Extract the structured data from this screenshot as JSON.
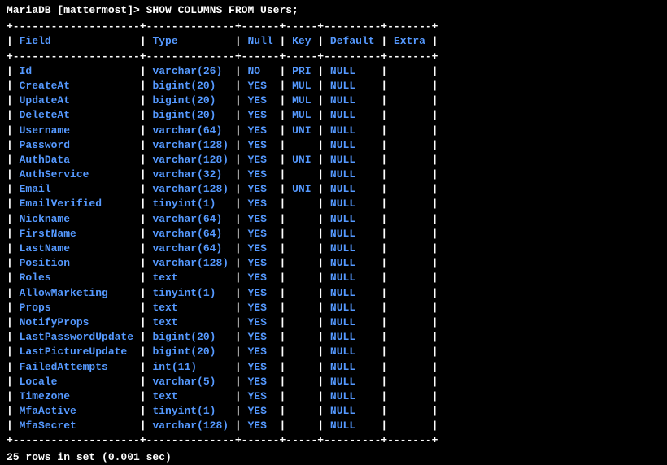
{
  "prompt": "MariaDB [mattermost]> SHOW COLUMNS FROM Users;",
  "border_top": "+--------------------+--------------+------+-----+---------+-------+",
  "border_mid": "+--------------------+--------------+------+-----+---------+-------+",
  "border_bottom": "+--------------------+--------------+------+-----+---------+-------+",
  "headers": {
    "field": "Field",
    "type": "Type",
    "null": "Null",
    "key": "Key",
    "default": "Default",
    "extra": "Extra"
  },
  "rows": [
    {
      "field": "Id",
      "type": "varchar(26)",
      "null": "NO",
      "key": "PRI",
      "default": "NULL",
      "extra": ""
    },
    {
      "field": "CreateAt",
      "type": "bigint(20)",
      "null": "YES",
      "key": "MUL",
      "default": "NULL",
      "extra": ""
    },
    {
      "field": "UpdateAt",
      "type": "bigint(20)",
      "null": "YES",
      "key": "MUL",
      "default": "NULL",
      "extra": ""
    },
    {
      "field": "DeleteAt",
      "type": "bigint(20)",
      "null": "YES",
      "key": "MUL",
      "default": "NULL",
      "extra": ""
    },
    {
      "field": "Username",
      "type": "varchar(64)",
      "null": "YES",
      "key": "UNI",
      "default": "NULL",
      "extra": ""
    },
    {
      "field": "Password",
      "type": "varchar(128)",
      "null": "YES",
      "key": "",
      "default": "NULL",
      "extra": ""
    },
    {
      "field": "AuthData",
      "type": "varchar(128)",
      "null": "YES",
      "key": "UNI",
      "default": "NULL",
      "extra": ""
    },
    {
      "field": "AuthService",
      "type": "varchar(32)",
      "null": "YES",
      "key": "",
      "default": "NULL",
      "extra": ""
    },
    {
      "field": "Email",
      "type": "varchar(128)",
      "null": "YES",
      "key": "UNI",
      "default": "NULL",
      "extra": ""
    },
    {
      "field": "EmailVerified",
      "type": "tinyint(1)",
      "null": "YES",
      "key": "",
      "default": "NULL",
      "extra": ""
    },
    {
      "field": "Nickname",
      "type": "varchar(64)",
      "null": "YES",
      "key": "",
      "default": "NULL",
      "extra": ""
    },
    {
      "field": "FirstName",
      "type": "varchar(64)",
      "null": "YES",
      "key": "",
      "default": "NULL",
      "extra": ""
    },
    {
      "field": "LastName",
      "type": "varchar(64)",
      "null": "YES",
      "key": "",
      "default": "NULL",
      "extra": ""
    },
    {
      "field": "Position",
      "type": "varchar(128)",
      "null": "YES",
      "key": "",
      "default": "NULL",
      "extra": ""
    },
    {
      "field": "Roles",
      "type": "text",
      "null": "YES",
      "key": "",
      "default": "NULL",
      "extra": ""
    },
    {
      "field": "AllowMarketing",
      "type": "tinyint(1)",
      "null": "YES",
      "key": "",
      "default": "NULL",
      "extra": ""
    },
    {
      "field": "Props",
      "type": "text",
      "null": "YES",
      "key": "",
      "default": "NULL",
      "extra": ""
    },
    {
      "field": "NotifyProps",
      "type": "text",
      "null": "YES",
      "key": "",
      "default": "NULL",
      "extra": ""
    },
    {
      "field": "LastPasswordUpdate",
      "type": "bigint(20)",
      "null": "YES",
      "key": "",
      "default": "NULL",
      "extra": ""
    },
    {
      "field": "LastPictureUpdate",
      "type": "bigint(20)",
      "null": "YES",
      "key": "",
      "default": "NULL",
      "extra": ""
    },
    {
      "field": "FailedAttempts",
      "type": "int(11)",
      "null": "YES",
      "key": "",
      "default": "NULL",
      "extra": ""
    },
    {
      "field": "Locale",
      "type": "varchar(5)",
      "null": "YES",
      "key": "",
      "default": "NULL",
      "extra": ""
    },
    {
      "field": "Timezone",
      "type": "text",
      "null": "YES",
      "key": "",
      "default": "NULL",
      "extra": ""
    },
    {
      "field": "MfaActive",
      "type": "tinyint(1)",
      "null": "YES",
      "key": "",
      "default": "NULL",
      "extra": ""
    },
    {
      "field": "MfaSecret",
      "type": "varchar(128)",
      "null": "YES",
      "key": "",
      "default": "NULL",
      "extra": ""
    }
  ],
  "footer": "25 rows in set (0.001 sec)",
  "widths": {
    "field": 18,
    "type": 12,
    "null": 4,
    "key": 3,
    "default": 7,
    "extra": 5
  }
}
